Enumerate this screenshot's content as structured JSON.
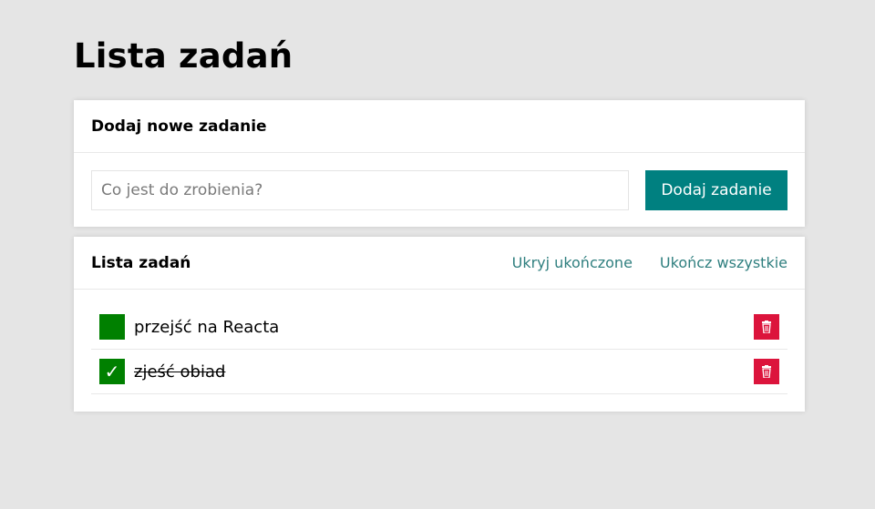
{
  "page": {
    "title": "Lista zadań"
  },
  "form_section": {
    "title": "Dodaj nowe zadanie",
    "input": {
      "value": "",
      "placeholder": "Co jest do zrobienia?"
    },
    "add_button_label": "Dodaj zadanie"
  },
  "list_section": {
    "title": "Lista zadań",
    "hide_done_label": "Ukryj ukończone",
    "complete_all_label": "Ukończ wszystkie"
  },
  "tasks": [
    {
      "content": "przejść na Reacta",
      "done": false,
      "toggle_icon": ""
    },
    {
      "content": "zjeść obiad",
      "done": true,
      "toggle_icon": "✓"
    }
  ],
  "icons": {
    "toggle": "checkmark-icon",
    "delete": "trash-icon"
  },
  "colors": {
    "background": "#e5e5e5",
    "accent": "#008080",
    "toggle": "#008000",
    "delete": "#dc143c",
    "link": "#2f7f7f"
  }
}
